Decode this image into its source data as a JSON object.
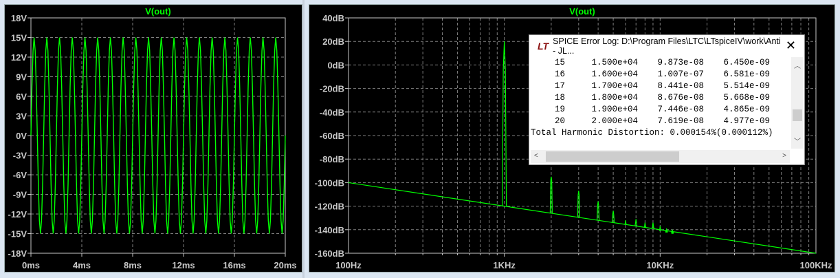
{
  "left_plot": {
    "trace_label": "V(out)",
    "y_ticks": [
      "18V",
      "15V",
      "12V",
      "9V",
      "6V",
      "3V",
      "0V",
      "-3V",
      "-6V",
      "-9V",
      "-12V",
      "-15V",
      "-18V"
    ],
    "x_ticks": [
      "0ms",
      "4ms",
      "8ms",
      "12ms",
      "16ms",
      "20ms"
    ],
    "trace_color": "#00ff00"
  },
  "chart_data": [
    {
      "type": "line",
      "title": "V(out)",
      "xlim": [
        0,
        20
      ],
      "xunit": "ms",
      "ylim": [
        -18,
        18
      ],
      "yunit": "V",
      "grid": true,
      "waveform": {
        "shape": "sine",
        "amplitude_V": 15,
        "frequency_Hz": 1000
      }
    },
    {
      "type": "line",
      "title": "V(out)",
      "xscale": "log",
      "xlim": [
        100,
        100000
      ],
      "xunit": "Hz",
      "ylim": [
        -160,
        40
      ],
      "yunit": "dB",
      "grid": true,
      "noise_floor": {
        "x": [
          100,
          100000
        ],
        "y": [
          -100,
          -160
        ]
      },
      "harmonics": {
        "freq_Hz": [
          1000,
          2000,
          3000,
          4000,
          5000,
          6000,
          7000,
          8000,
          9000,
          10000,
          11000,
          12000
        ],
        "peak_dB": [
          20,
          -95,
          -107,
          -116,
          -124,
          -132,
          -131,
          -134,
          -134,
          -137,
          -139,
          -140
        ]
      }
    }
  ],
  "right_plot": {
    "trace_label": "V(out)",
    "y_ticks": [
      "40dB",
      "20dB",
      "0dB",
      "-20dB",
      "-40dB",
      "-60dB",
      "-80dB",
      "-100dB",
      "-120dB",
      "-140dB",
      "-160dB"
    ],
    "x_ticks": [
      "100Hz",
      "1KHz",
      "10KHz",
      "100KHz"
    ]
  },
  "error_log": {
    "logo": "LT",
    "title": "SPICE Error Log: D:\\Program Files\\LTC\\LTspiceIV\\work\\Anti - JL...",
    "rows": [
      [
        "15",
        "1.500e+04",
        "9.873e-08",
        "6.450e-09"
      ],
      [
        "16",
        "1.600e+04",
        "1.007e-07",
        "6.581e-09"
      ],
      [
        "17",
        "1.700e+04",
        "8.441e-08",
        "5.514e-09"
      ],
      [
        "18",
        "1.800e+04",
        "8.676e-08",
        "5.668e-09"
      ],
      [
        "19",
        "1.900e+04",
        "7.446e-08",
        "4.865e-09"
      ],
      [
        "20",
        "2.000e+04",
        "7.619e-08",
        "4.977e-09"
      ]
    ],
    "thd": "Total Harmonic Distortion: 0.000154%(0.000112%)"
  }
}
